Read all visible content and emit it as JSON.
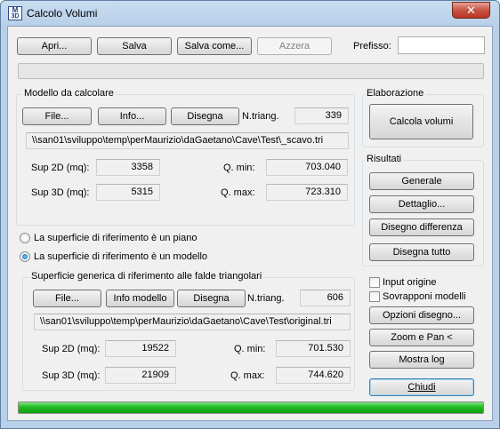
{
  "window": {
    "title": "Calcolo Volumi",
    "icon_text_top": "M",
    "icon_text_bottom": "3D",
    "close_glyph": "✕"
  },
  "toolbar": {
    "open_label": "Apri...",
    "save_label": "Salva",
    "save_as_label": "Salva come...",
    "reset_label": "Azzera",
    "prefix_label": "Prefisso:",
    "prefix_value": ""
  },
  "model": {
    "group_title": "Modello da calcolare",
    "file_label": "File...",
    "info_label": "Info...",
    "draw_label": "Disegna",
    "ntriang_label": "N.triang.",
    "ntriang_value": "339",
    "path": "\\\\san01\\sviluppo\\temp\\perMaurizio\\daGaetano\\Cave\\Test\\_scavo.tri",
    "sup2d_label": "Sup 2D (mq):",
    "sup2d_value": "3358",
    "sup3d_label": "Sup 3D (mq):",
    "sup3d_value": "5315",
    "qmin_label": "Q. min:",
    "qmin_value": "703.040",
    "qmax_label": "Q. max:",
    "qmax_value": "723.310"
  },
  "processing": {
    "group_title": "Elaborazione",
    "calc_label": "Calcola volumi"
  },
  "results": {
    "group_title": "Risultati",
    "general_label": "Generale",
    "detail_label": "Dettaglio...",
    "diff_label": "Disegno differenza",
    "draw_all_label": "Disegna tutto"
  },
  "reference": {
    "option_plane": "La superficie di riferimento è un piano",
    "option_model": "La superficie di riferimento è un modello",
    "selected": "model"
  },
  "ref_model": {
    "group_title": "Superficie generica di riferimento alle falde triangolari",
    "file_label": "File...",
    "info_label": "Info modello",
    "draw_label": "Disegna",
    "ntriang_label": "N.triang.",
    "ntriang_value": "606",
    "path": "\\\\san01\\sviluppo\\temp\\perMaurizio\\daGaetano\\Cave\\Test\\original.tri",
    "sup2d_label": "Sup 2D (mq):",
    "sup2d_value": "19522",
    "sup3d_label": "Sup 3D (mq):",
    "sup3d_value": "21909",
    "qmin_label": "Q. min:",
    "qmin_value": "701.530",
    "qmax_label": "Q. max:",
    "qmax_value": "744.620"
  },
  "options": {
    "input_origin_label": "Input origine",
    "input_origin_checked": false,
    "overlay_label": "Sovrapponi modelli",
    "overlay_checked": false,
    "draw_options_label": "Opzioni disegno...",
    "zoom_pan_label": "Zoom e Pan <",
    "show_log_label": "Mostra log",
    "close_label": "Chiudi"
  },
  "progress": {
    "fraction": 1.0
  },
  "colors": {
    "progress_fill": "#22bb22",
    "close_button": "#c75343",
    "frame": "#b9d0ea"
  }
}
